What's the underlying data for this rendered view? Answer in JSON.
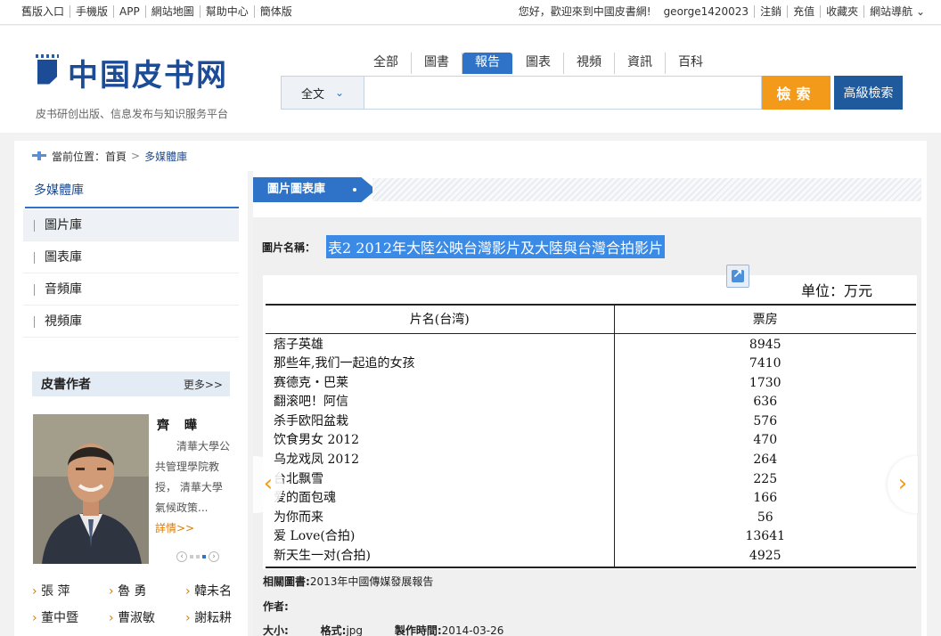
{
  "topbar": {
    "left_links": [
      "舊版入口",
      "手機版",
      "APP",
      "網站地圖",
      "幫助中心",
      "簡体版"
    ],
    "welcome": "您好，歡迎來到中國皮書網!",
    "username": "george1420023",
    "right_links": [
      "注銷",
      "充值",
      "收藏夾",
      "網站導航 ⌄"
    ]
  },
  "header": {
    "logo_text": "中国皮书网",
    "slogan": "皮书研创出版、信息发布与知识服务平台",
    "tabs": [
      "全部",
      "圖書",
      "報告",
      "圖表",
      "視頻",
      "資訊",
      "百科"
    ],
    "active_tab": "報告",
    "search_scope": "全文",
    "search_value": "",
    "search_button": "檢索",
    "advanced_button": "高級檢索"
  },
  "breadcrumb": {
    "label": "當前位置：",
    "home": "首頁",
    "current": "多媒體庫"
  },
  "sidebar": {
    "title": "多媒體庫",
    "items": [
      "圖片庫",
      "圖表庫",
      "音頻庫",
      "視頻庫"
    ],
    "active_item": "圖片庫",
    "author_section": {
      "title": "皮書作者",
      "more": "更多>>",
      "name": "齊 曄",
      "desc": "清華大學公共管理學院教授， 清華大學氣候政策...",
      "detail": "詳情>>",
      "links": [
        "張 萍",
        "魯 勇",
        "韓未名",
        "董中暨",
        "曹淑敏",
        "謝耘耕"
      ]
    }
  },
  "main": {
    "tab_label": "圖片圖表庫",
    "name_label": "圖片名稱：",
    "name_value": "表2 2012年大陸公映台灣影片及大陸與台灣合拍影片",
    "unit": "单位：万元",
    "table": {
      "headers": [
        "片名(台湾)",
        "票房"
      ],
      "rows": [
        [
          "痞子英雄",
          "8945"
        ],
        [
          "那些年,我们一起追的女孩",
          "7410"
        ],
        [
          "赛德克・巴莱",
          "1730"
        ],
        [
          "翻滚吧！阿信",
          "636"
        ],
        [
          "杀手欧阳盆栽",
          "576"
        ],
        [
          "饮食男女 2012",
          "470"
        ],
        [
          "乌龙戏凤 2012",
          "264"
        ],
        [
          "台北飘雪",
          "225"
        ],
        [
          "爱的面包魂",
          "166"
        ],
        [
          "为你而来",
          "56"
        ],
        [
          "爱 Love(合拍)",
          "13641"
        ],
        [
          "新天生一对(合拍)",
          "4925"
        ]
      ]
    },
    "related_label": "相關圖書:",
    "related_value": "2013年中國傳媒發展報告",
    "author_label": "作者:",
    "size_label": "大小:",
    "format_label": "格式:",
    "format_value": "jpg",
    "time_label": "製作時間:",
    "time_value": "2014-03-26"
  },
  "colors": {
    "brand_blue": "#1d4c97",
    "accent_blue": "#2e73c8",
    "search_orange": "#f39a1a"
  }
}
